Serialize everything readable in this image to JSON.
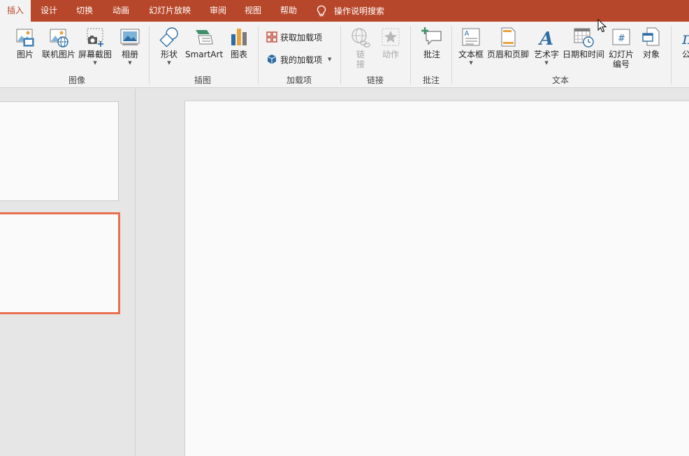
{
  "tabs": [
    {
      "label": "插入",
      "active": true
    },
    {
      "label": "设计"
    },
    {
      "label": "切换"
    },
    {
      "label": "动画"
    },
    {
      "label": "幻灯片放映"
    },
    {
      "label": "审阅"
    },
    {
      "label": "视图"
    },
    {
      "label": "帮助"
    }
  ],
  "tell_me": "操作说明搜索",
  "groups": {
    "images": {
      "label": "图像",
      "picture": "图片",
      "online_picture": "联机图片",
      "screenshot": "屏幕截图",
      "album": "相册"
    },
    "illustrations": {
      "label": "插图",
      "shapes": "形状",
      "smartart": "SmartArt",
      "chart": "图表"
    },
    "addins": {
      "label": "加载项",
      "get": "获取加载项",
      "mine": "我的加载项"
    },
    "links": {
      "label": "链接",
      "link_line1": "链",
      "link_line2": "接",
      "action": "动作"
    },
    "comments": {
      "label": "批注",
      "comment": "批注"
    },
    "text": {
      "label": "文本",
      "textbox": "文本框",
      "header_footer": "页眉和页脚",
      "wordart": "艺术字",
      "datetime": "日期和时间",
      "slide_num_line1": "幻灯片",
      "slide_num_line2": "编号",
      "object": "对象",
      "equation_partial": "公"
    }
  },
  "colors": {
    "accent": "#b7472a",
    "selection": "#e8704f"
  }
}
